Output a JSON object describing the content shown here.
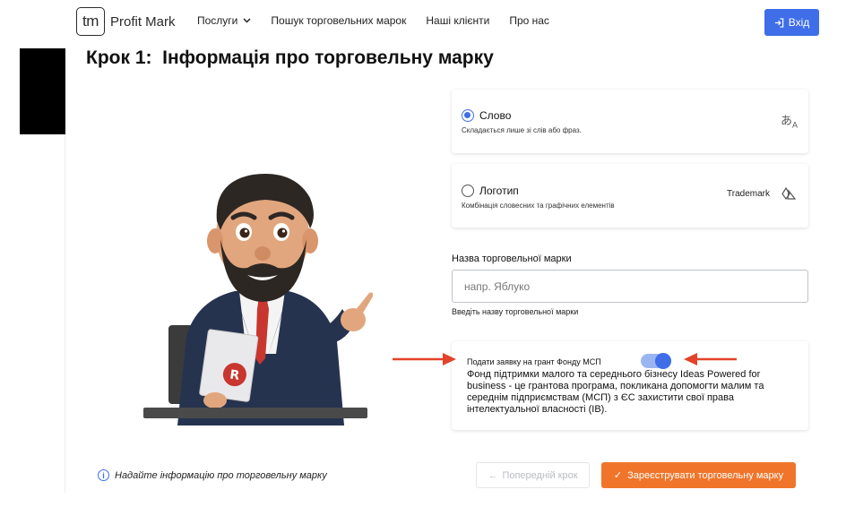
{
  "header": {
    "logo_mark": "tm",
    "logo_text": "Profit Mark",
    "nav": [
      {
        "label": "Послуги",
        "has_dropdown": true
      },
      {
        "label": "Пошук торговельних марок"
      },
      {
        "label": "Наші клієнти"
      },
      {
        "label": "Про нас"
      }
    ],
    "login_label": "Вхід"
  },
  "page_title": "Крок 1:  Інформація про торговельну марку",
  "options": [
    {
      "title": "Слово",
      "subtitle": "Складається лише зі слів або фраз.",
      "selected": true,
      "icon": "translate-icon"
    },
    {
      "title": "Логотип",
      "subtitle": "Комбінація словесних та графічних елементів",
      "selected": false,
      "tag": "Trademark",
      "icon": "shapes-icon"
    }
  ],
  "trademark_field": {
    "label": "Назва торговельної марки",
    "placeholder": "напр. Яблуко",
    "value": "",
    "help": "Введіть назву торговельної марки"
  },
  "grant": {
    "title": "Подати заявку на грант Фонду МСП",
    "enabled": true,
    "text": "Фонд підтримки малого та середнього бізнесу Ideas Powered for business - це грантова програма, покликана допомогти малим та середнім підприємствам (МСП) з ЄС захистити свої права інтелектуальної власності (ІВ)."
  },
  "footer": {
    "info": "Надайте інформацію про торговельну марку",
    "prev_label": "Попередній крок",
    "register_label": "Зареєструвати торговельну марку"
  },
  "colors": {
    "accent": "#3f6ee8",
    "register": "#f0752b",
    "annotation_arrow": "#e2432a"
  }
}
